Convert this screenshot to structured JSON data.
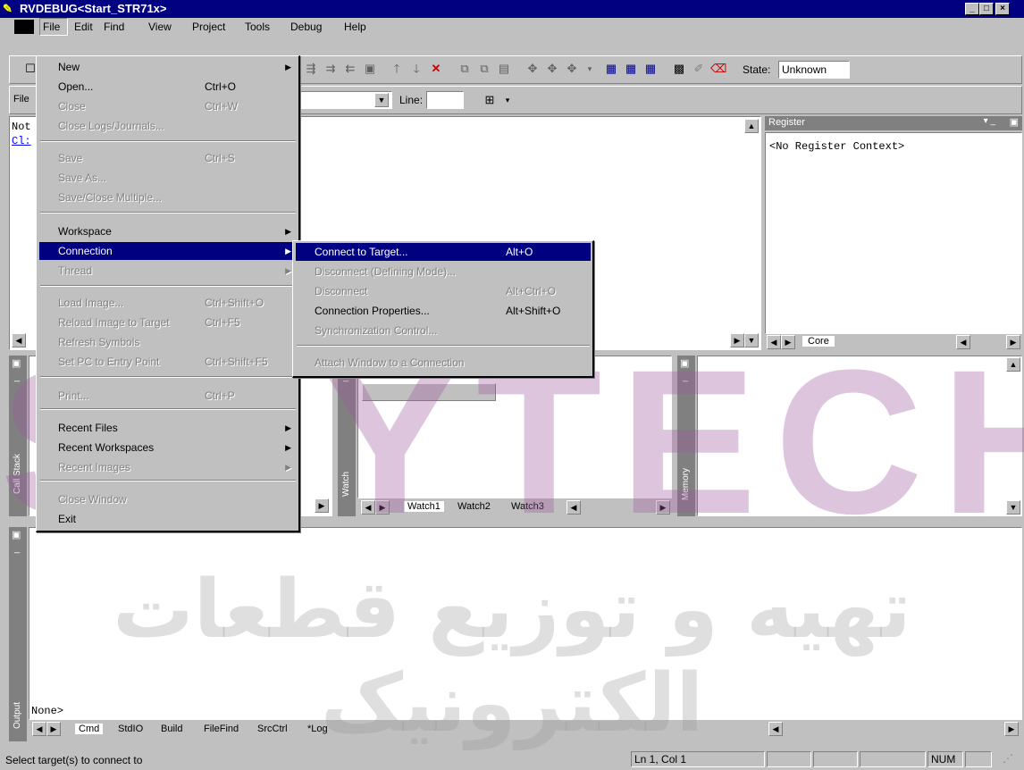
{
  "window": {
    "title": "RVDEBUG<Start_STR71x>",
    "min": "_",
    "max": "□",
    "close": "×"
  },
  "menubar": [
    "File",
    "Edit",
    "Find",
    "View",
    "Project",
    "Tools",
    "Debug",
    "Help"
  ],
  "toolbar": {
    "state_label": "State:",
    "state_value": "Unknown",
    "line_label": "Line:",
    "file_label": "File"
  },
  "editor": {
    "line1": "Not",
    "line2": "Cl:"
  },
  "register": {
    "title": "Register",
    "content": "<No Register Context>",
    "tab": "Core"
  },
  "watch": {
    "label": "Watch",
    "tabs": [
      "Watch1",
      "Watch2",
      "Watch3"
    ]
  },
  "callstack": {
    "label": "Call Stack"
  },
  "memory": {
    "label": "Memory"
  },
  "output": {
    "label": "Output",
    "text": "None>",
    "tabs": [
      "Cmd",
      "StdIO",
      "Build",
      "FileFind",
      "SrcCtrl",
      "*Log"
    ]
  },
  "file_menu": [
    {
      "label": "New",
      "shortcut": "",
      "disabled": false,
      "sub": true
    },
    {
      "label": "Open...",
      "shortcut": "Ctrl+O",
      "disabled": false
    },
    {
      "label": "Close",
      "shortcut": "Ctrl+W",
      "disabled": true
    },
    {
      "label": "Close Logs/Journals...",
      "shortcut": "",
      "disabled": true
    },
    {
      "label": "Save",
      "shortcut": "Ctrl+S",
      "disabled": true
    },
    {
      "label": "Save As...",
      "shortcut": "",
      "disabled": true
    },
    {
      "label": "Save/Close Multiple...",
      "shortcut": "",
      "disabled": true
    },
    {
      "label": "Workspace",
      "shortcut": "",
      "disabled": false,
      "sub": true
    },
    {
      "label": "Connection",
      "shortcut": "",
      "disabled": false,
      "sub": true,
      "selected": true
    },
    {
      "label": "Thread",
      "shortcut": "",
      "disabled": true,
      "sub": true
    },
    {
      "label": "Load Image...",
      "shortcut": "Ctrl+Shift+O",
      "disabled": true
    },
    {
      "label": "Reload Image to Target",
      "shortcut": "Ctrl+F5",
      "disabled": true
    },
    {
      "label": "Refresh Symbols",
      "shortcut": "",
      "disabled": true
    },
    {
      "label": "Set PC to Entry Point",
      "shortcut": "Ctrl+Shift+F5",
      "disabled": true
    },
    {
      "label": "Print...",
      "shortcut": "Ctrl+P",
      "disabled": true
    },
    {
      "label": "Recent Files",
      "shortcut": "",
      "disabled": false,
      "sub": true
    },
    {
      "label": "Recent Workspaces",
      "shortcut": "",
      "disabled": false,
      "sub": true
    },
    {
      "label": "Recent Images",
      "shortcut": "",
      "disabled": true,
      "sub": true
    },
    {
      "label": "Close Window",
      "shortcut": "",
      "disabled": true
    },
    {
      "label": "Exit",
      "shortcut": "",
      "disabled": false
    }
  ],
  "connection_menu": [
    {
      "label": "Connect to Target...",
      "shortcut": "Alt+O",
      "disabled": false,
      "selected": true
    },
    {
      "label": "Disconnect (Defining Mode)...",
      "shortcut": "",
      "disabled": true
    },
    {
      "label": "Disconnect",
      "shortcut": "Alt+Ctrl+O",
      "disabled": true
    },
    {
      "label": "Connection Properties...",
      "shortcut": "Alt+Shift+O",
      "disabled": false
    },
    {
      "label": "Synchronization Control...",
      "shortcut": "",
      "disabled": true
    },
    {
      "label": "Attach Window to a Connection",
      "shortcut": "",
      "disabled": true
    }
  ],
  "status": {
    "message": "Select target(s) to connect to",
    "position": "Ln 1, Col 1",
    "num": "NUM"
  },
  "watermark": {
    "brand": "SKYTECH",
    "persian": "تهیه و توزیع قطعات الکترونیک"
  },
  "colors": {
    "title": "#000080",
    "face": "#c0c0c0",
    "watermark": "#a05aa0"
  }
}
